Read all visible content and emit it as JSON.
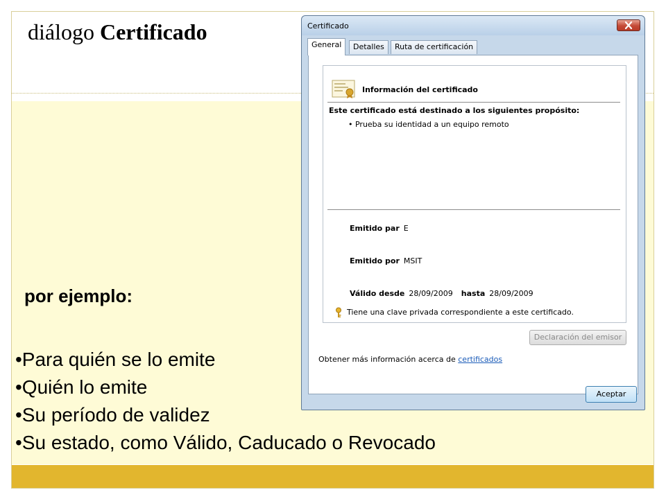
{
  "slide": {
    "title_prefix": "diálogo ",
    "title_bold": "Certificado",
    "example_heading": "por ejemplo:",
    "bullets": [
      "•Para quién se lo emite",
      "•Quién lo emite",
      "•Su período de validez",
      "•Su estado, como Válido, Caducado o Revocado"
    ]
  },
  "dialog": {
    "title": "Certificado",
    "tabs": [
      "General",
      "Detalles",
      "Ruta de certificación"
    ],
    "info_title": "Información del certificado",
    "purpose_title": "Este certificado está destinado a los siguientes propósito:",
    "purpose_item": "• Prueba su identidad a un equipo remoto",
    "issued_to_label": "Emitido par",
    "issued_to_value": "E",
    "issued_by_label": "Emitido por",
    "issued_by_value": "MSIT",
    "valid_from_label": "Válido desde",
    "valid_from_value": "28/09/2009",
    "valid_to_label": "hasta",
    "valid_to_value": "28/09/2009",
    "private_key_note": "Tiene una clave privada correspondiente a este certificado.",
    "issuer_statement_button": "Declaración del emisor",
    "more_info_text": "Obtener más información acerca de ",
    "more_info_link": "certificados",
    "ok_button": "Aceptar"
  },
  "colors": {
    "content_background": "#fefbd6",
    "bottom_band": "#e2b62e",
    "link": "#1a5bb8"
  },
  "icons": {
    "certificate": "certificate-icon",
    "key": "key-icon",
    "close": "close-icon"
  }
}
